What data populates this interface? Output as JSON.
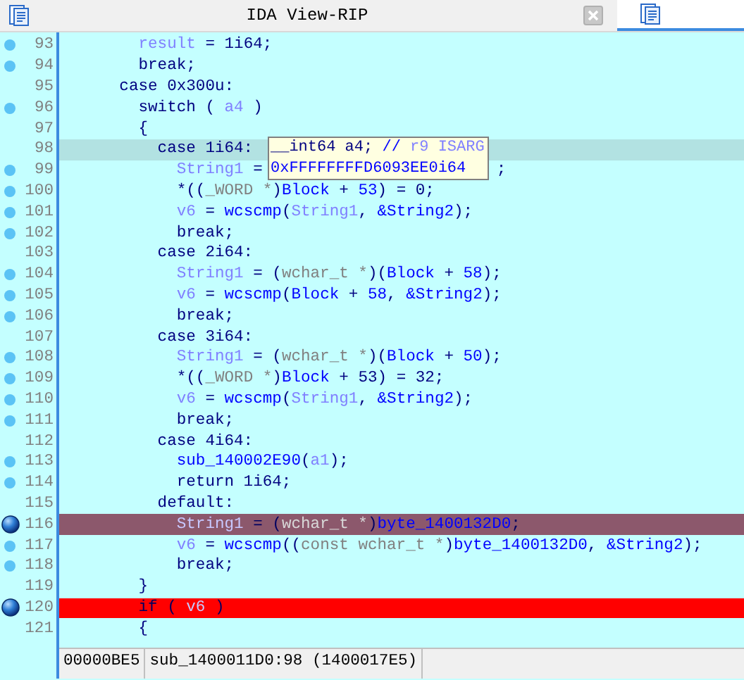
{
  "tabs": [
    {
      "title": "IDA View-RIP",
      "selected": false,
      "closable": true
    },
    {
      "selected": true,
      "closable": false
    }
  ],
  "lines": [
    {
      "number": "93",
      "dot": true,
      "breakpoint": false,
      "current": false,
      "tokens": [
        {
          "text": "        result",
          "kind": "local"
        },
        {
          "text": " = 1i64;",
          "kind": "code"
        }
      ]
    },
    {
      "number": "94",
      "dot": true,
      "breakpoint": false,
      "current": false,
      "tokens": [
        {
          "text": "        break;",
          "kind": "code"
        }
      ]
    },
    {
      "number": "95",
      "dot": false,
      "breakpoint": false,
      "current": false,
      "tokens": [
        {
          "text": "      case 0x300u:",
          "kind": "code"
        }
      ]
    },
    {
      "number": "96",
      "dot": true,
      "breakpoint": false,
      "current": false,
      "tokens": [
        {
          "text": "        switch ( ",
          "kind": "code"
        },
        {
          "text": "a4",
          "kind": "local"
        },
        {
          "text": " )",
          "kind": "code"
        }
      ]
    },
    {
      "number": "97",
      "dot": false,
      "breakpoint": false,
      "current": false,
      "tokens": [
        {
          "text": "        {",
          "kind": "code"
        }
      ]
    },
    {
      "number": "98",
      "dot": false,
      "breakpoint": false,
      "current": true,
      "tokens": [
        {
          "text": "          case 1i64:",
          "kind": "code"
        }
      ]
    },
    {
      "number": "99",
      "dot": true,
      "breakpoint": false,
      "current": false,
      "tokens": [
        {
          "text": "            String1",
          "kind": "local"
        },
        {
          "text": " =",
          "kind": "code"
        }
      ],
      "tail": [
        {
          "text": ";",
          "kind": "code"
        }
      ]
    },
    {
      "number": "100",
      "dot": true,
      "breakpoint": false,
      "current": false,
      "tokens": [
        {
          "text": "            *((",
          "kind": "code"
        },
        {
          "text": "_WORD *",
          "kind": "type"
        },
        {
          "text": ")",
          "kind": "code"
        },
        {
          "text": "Block",
          "kind": "name"
        },
        {
          "text": " + ",
          "kind": "code"
        },
        {
          "text": "53",
          "kind": "name"
        },
        {
          "text": ") = 0;",
          "kind": "code"
        }
      ]
    },
    {
      "number": "101",
      "dot": true,
      "breakpoint": false,
      "current": false,
      "tokens": [
        {
          "text": "            v6",
          "kind": "local"
        },
        {
          "text": " = ",
          "kind": "code"
        },
        {
          "text": "wcscmp",
          "kind": "name"
        },
        {
          "text": "(",
          "kind": "code"
        },
        {
          "text": "String1",
          "kind": "local"
        },
        {
          "text": ", ",
          "kind": "code"
        },
        {
          "text": "&String2",
          "kind": "name"
        },
        {
          "text": ");",
          "kind": "code"
        }
      ]
    },
    {
      "number": "102",
      "dot": true,
      "breakpoint": false,
      "current": false,
      "tokens": [
        {
          "text": "            break;",
          "kind": "code"
        }
      ]
    },
    {
      "number": "103",
      "dot": false,
      "breakpoint": false,
      "current": false,
      "tokens": [
        {
          "text": "          case 2i64:",
          "kind": "code"
        }
      ]
    },
    {
      "number": "104",
      "dot": true,
      "breakpoint": false,
      "current": false,
      "tokens": [
        {
          "text": "            String1",
          "kind": "local"
        },
        {
          "text": " = (",
          "kind": "code"
        },
        {
          "text": "wchar_t *",
          "kind": "type"
        },
        {
          "text": ")(",
          "kind": "code"
        },
        {
          "text": "Block",
          "kind": "name"
        },
        {
          "text": " + ",
          "kind": "code"
        },
        {
          "text": "58",
          "kind": "name"
        },
        {
          "text": ");",
          "kind": "code"
        }
      ]
    },
    {
      "number": "105",
      "dot": true,
      "breakpoint": false,
      "current": false,
      "tokens": [
        {
          "text": "            v6",
          "kind": "local"
        },
        {
          "text": " = ",
          "kind": "code"
        },
        {
          "text": "wcscmp",
          "kind": "name"
        },
        {
          "text": "(",
          "kind": "code"
        },
        {
          "text": "Block",
          "kind": "name"
        },
        {
          "text": " + ",
          "kind": "code"
        },
        {
          "text": "58",
          "kind": "name"
        },
        {
          "text": ", ",
          "kind": "code"
        },
        {
          "text": "&String2",
          "kind": "name"
        },
        {
          "text": ");",
          "kind": "code"
        }
      ]
    },
    {
      "number": "106",
      "dot": true,
      "breakpoint": false,
      "current": false,
      "tokens": [
        {
          "text": "            break;",
          "kind": "code"
        }
      ]
    },
    {
      "number": "107",
      "dot": false,
      "breakpoint": false,
      "current": false,
      "tokens": [
        {
          "text": "          case 3i64:",
          "kind": "code"
        }
      ]
    },
    {
      "number": "108",
      "dot": true,
      "breakpoint": false,
      "current": false,
      "tokens": [
        {
          "text": "            String1",
          "kind": "local"
        },
        {
          "text": " = (",
          "kind": "code"
        },
        {
          "text": "wchar_t *",
          "kind": "type"
        },
        {
          "text": ")(",
          "kind": "code"
        },
        {
          "text": "Block",
          "kind": "name"
        },
        {
          "text": " + ",
          "kind": "code"
        },
        {
          "text": "50",
          "kind": "name"
        },
        {
          "text": ");",
          "kind": "code"
        }
      ]
    },
    {
      "number": "109",
      "dot": true,
      "breakpoint": false,
      "current": false,
      "tokens": [
        {
          "text": "            *((",
          "kind": "code"
        },
        {
          "text": "_WORD *",
          "kind": "type"
        },
        {
          "text": ")",
          "kind": "code"
        },
        {
          "text": "Block",
          "kind": "name"
        },
        {
          "text": " + 53) = 32;",
          "kind": "code"
        }
      ]
    },
    {
      "number": "110",
      "dot": true,
      "breakpoint": false,
      "current": false,
      "tokens": [
        {
          "text": "            v6",
          "kind": "local"
        },
        {
          "text": " = ",
          "kind": "code"
        },
        {
          "text": "wcscmp",
          "kind": "name"
        },
        {
          "text": "(",
          "kind": "code"
        },
        {
          "text": "String1",
          "kind": "local"
        },
        {
          "text": ", ",
          "kind": "code"
        },
        {
          "text": "&String2",
          "kind": "name"
        },
        {
          "text": ");",
          "kind": "code"
        }
      ]
    },
    {
      "number": "111",
      "dot": true,
      "breakpoint": false,
      "current": false,
      "tokens": [
        {
          "text": "            break;",
          "kind": "code"
        }
      ]
    },
    {
      "number": "112",
      "dot": false,
      "breakpoint": false,
      "current": false,
      "tokens": [
        {
          "text": "          case 4i64:",
          "kind": "code"
        }
      ]
    },
    {
      "number": "113",
      "dot": true,
      "breakpoint": false,
      "current": false,
      "tokens": [
        {
          "text": "            sub_140002E90",
          "kind": "name"
        },
        {
          "text": "(",
          "kind": "code"
        },
        {
          "text": "a1",
          "kind": "local"
        },
        {
          "text": ");",
          "kind": "code"
        }
      ]
    },
    {
      "number": "114",
      "dot": true,
      "breakpoint": false,
      "current": false,
      "tokens": [
        {
          "text": "            return 1i64;",
          "kind": "code"
        }
      ]
    },
    {
      "number": "115",
      "dot": false,
      "breakpoint": false,
      "current": false,
      "tokens": [
        {
          "text": "          default:",
          "kind": "code"
        }
      ]
    },
    {
      "number": "116",
      "dot": false,
      "breakpoint": true,
      "current": false,
      "color": "#8c586c",
      "tokens": [
        {
          "text": "            String1",
          "kind": "local"
        },
        {
          "text": " = (",
          "kind": "code"
        },
        {
          "text": "wchar_t *",
          "kind": "type"
        },
        {
          "text": ")",
          "kind": "code"
        },
        {
          "text": "byte_1400132D0",
          "kind": "name"
        },
        {
          "text": ";",
          "kind": "code"
        }
      ]
    },
    {
      "number": "117",
      "dot": true,
      "breakpoint": false,
      "current": false,
      "tokens": [
        {
          "text": "            v6",
          "kind": "local"
        },
        {
          "text": " = ",
          "kind": "code"
        },
        {
          "text": "wcscmp",
          "kind": "name"
        },
        {
          "text": "((",
          "kind": "code"
        },
        {
          "text": "const wchar_t *",
          "kind": "type"
        },
        {
          "text": ")",
          "kind": "code"
        },
        {
          "text": "byte_1400132D0",
          "kind": "name"
        },
        {
          "text": ", ",
          "kind": "code"
        },
        {
          "text": "&String2",
          "kind": "name"
        },
        {
          "text": ");",
          "kind": "code"
        }
      ]
    },
    {
      "number": "118",
      "dot": true,
      "breakpoint": false,
      "current": false,
      "tokens": [
        {
          "text": "            break;",
          "kind": "code"
        }
      ]
    },
    {
      "number": "119",
      "dot": false,
      "breakpoint": false,
      "current": false,
      "tokens": [
        {
          "text": "        }",
          "kind": "code"
        }
      ]
    },
    {
      "number": "120",
      "dot": false,
      "breakpoint": true,
      "current": false,
      "color": "#ff0000",
      "tokens": [
        {
          "text": "        if ( ",
          "kind": "code"
        },
        {
          "text": "v6",
          "kind": "local"
        },
        {
          "text": " )",
          "kind": "code"
        }
      ]
    },
    {
      "number": "121",
      "dot": false,
      "breakpoint": false,
      "current": false,
      "tokens": [
        {
          "text": "        {",
          "kind": "code"
        }
      ]
    }
  ],
  "tooltip": {
    "lines": [
      [
        {
          "text": "__int64 a4; ",
          "kind": "code"
        },
        {
          "text": "// ",
          "kind": "name"
        },
        {
          "text": "r9 ISARG",
          "kind": "local"
        }
      ],
      [
        {
          "text": "0xFFFFFFFFD6093EE0i64",
          "kind": "name"
        }
      ]
    ]
  },
  "status_bar": {
    "address": "00000BE5",
    "location": "sub_1400011D0:98 (1400017E5)"
  }
}
